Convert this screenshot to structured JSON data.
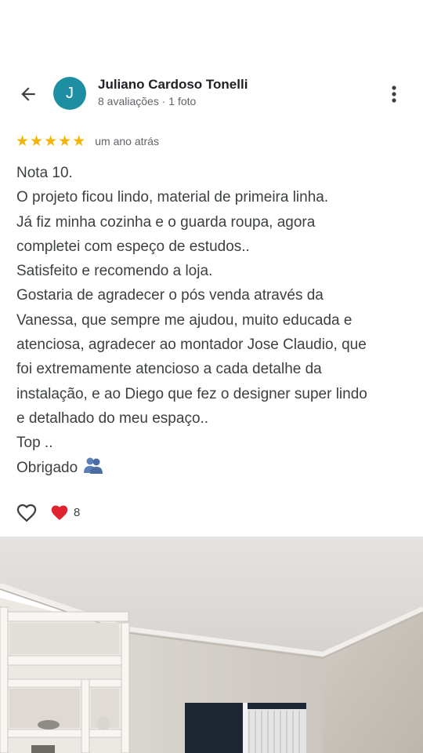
{
  "header": {
    "author_initial": "J",
    "author_name": "Juliano Cardoso Tonelli",
    "author_meta": "8 avaliações · 1 foto"
  },
  "review": {
    "rating": 5,
    "time_ago": "um ano atrás",
    "lines": [
      "Nota 10.",
      "O projeto ficou lindo, material de primeira linha.",
      "Já fiz minha cozinha e o guarda roupa, agora",
      "completei com espeço de estudos..",
      "Satisfeito e recomendo a loja.",
      "Gostaria de agradecer o pós venda através da",
      "Vanessa, que sempre me ajudou, muito educada e",
      "atenciosa, agradecer ao montador Jose Claudio, que",
      "foi extremamente atencioso a cada detalhe da",
      "instalação, e ao Diego que fez o designer super lindo",
      "e detalhado do meu espaço..",
      "Top ..",
      "Obrigado"
    ]
  },
  "reactions": {
    "heart_count": "8"
  },
  "colors": {
    "avatar": "#1e8fa3",
    "star": "#f4b400",
    "heart": "#e0242f"
  },
  "icons": [
    "back-arrow-icon",
    "more-vert-icon",
    "star-icon",
    "heart-outline-icon",
    "heart-filled-icon",
    "people-emoji-icon"
  ]
}
